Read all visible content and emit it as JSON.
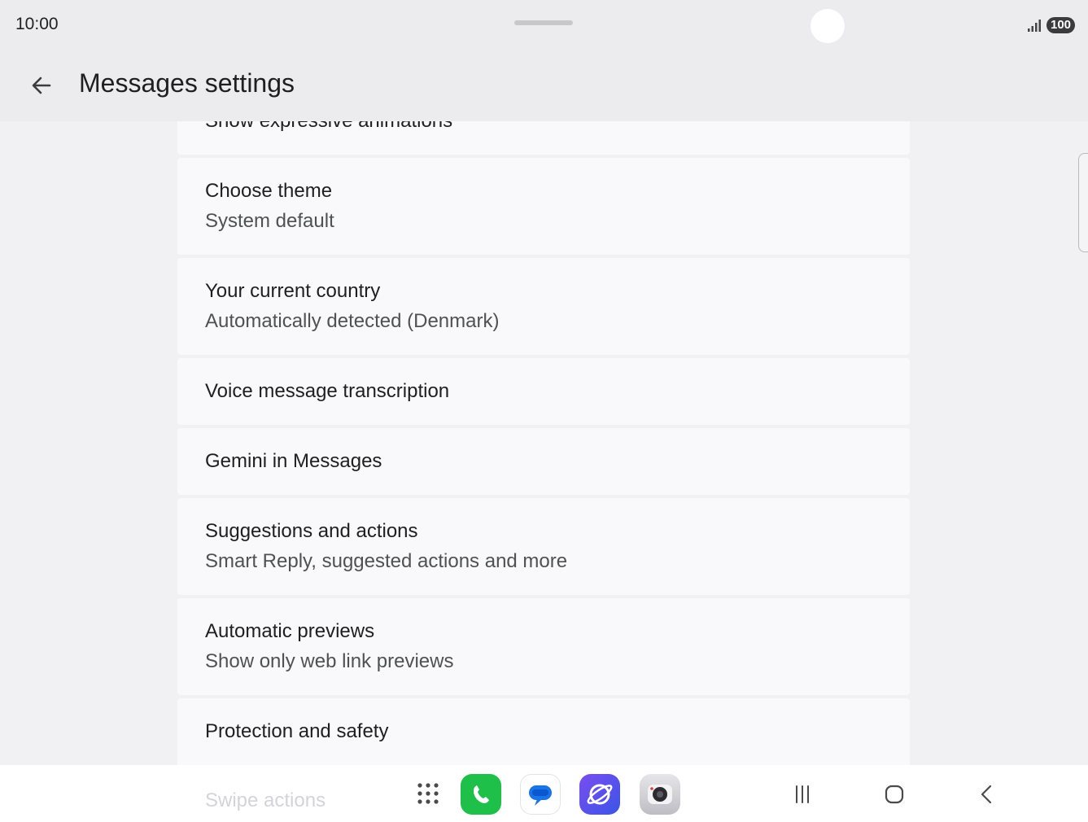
{
  "status_bar": {
    "time": "10:00",
    "battery": "100"
  },
  "app_bar": {
    "title": "Messages settings"
  },
  "settings": {
    "partial_top": {
      "title": "Show expressive animations",
      "toggle_on": true
    },
    "items": [
      {
        "title": "Choose theme",
        "subtitle": "System default"
      },
      {
        "title": "Your current country",
        "subtitle": "Automatically detected (Denmark)"
      },
      {
        "title": "Voice message transcription"
      },
      {
        "title": "Gemini in Messages"
      },
      {
        "title": "Suggestions and actions",
        "subtitle": "Smart Reply, suggested actions and more"
      },
      {
        "title": "Automatic previews",
        "subtitle": "Show only web link previews"
      },
      {
        "title": "Protection and safety"
      }
    ],
    "obscured_item": "Swipe actions"
  },
  "taskbar": {
    "apps": [
      "apps-grid-icon",
      "phone-icon",
      "messages-icon",
      "internet-icon",
      "camera-icon"
    ],
    "nav": [
      "recents-icon",
      "home-icon",
      "back-icon"
    ]
  },
  "colors": {
    "toggle_accent": "#3a6fe8",
    "phone_green": "#1ec04a",
    "messages_blue": "#1a73e8",
    "internet_purple": "#5b4de6"
  }
}
